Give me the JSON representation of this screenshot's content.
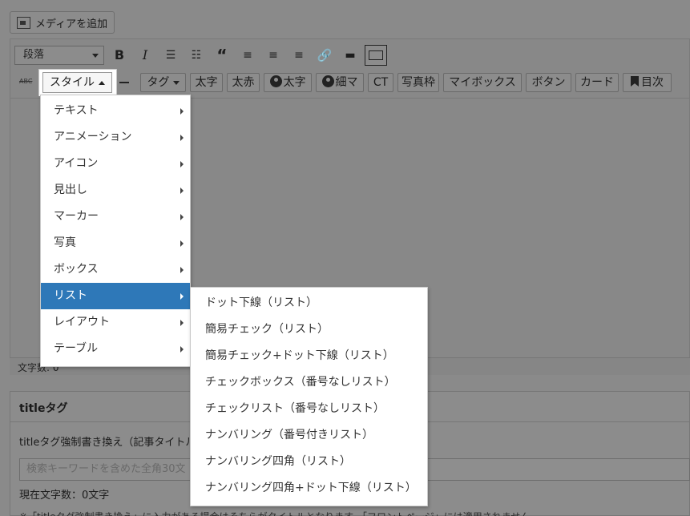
{
  "media_button": {
    "label": "メディアを追加"
  },
  "toolbar": {
    "format_select": "段落",
    "row2_buttons": {
      "style": "スタイル",
      "tag": "タグ",
      "bold": "太字",
      "bold_red": "太赤",
      "avatar_bold": "太字",
      "avatar_thin": "細マ",
      "ct": "CT",
      "photo_frame": "写真枠",
      "my_box": "マイボックス",
      "button": "ボタン",
      "card": "カード",
      "toc": "目次"
    },
    "strikethrough_label": "ABC"
  },
  "style_menu": {
    "items": [
      {
        "label": "テキスト"
      },
      {
        "label": "アニメーション"
      },
      {
        "label": "アイコン"
      },
      {
        "label": "見出し"
      },
      {
        "label": "マーカー"
      },
      {
        "label": "写真"
      },
      {
        "label": "ボックス"
      },
      {
        "label": "リスト"
      },
      {
        "label": "レイアウト"
      },
      {
        "label": "テーブル"
      }
    ],
    "active_index": 7
  },
  "list_submenu": {
    "items": [
      {
        "label": "ドット下線（リスト）"
      },
      {
        "label": "簡易チェック（リスト）"
      },
      {
        "label": "簡易チェック+ドット下線（リスト）"
      },
      {
        "label": "チェックボックス（番号なしリスト）"
      },
      {
        "label": "チェックリスト（番号なしリスト）"
      },
      {
        "label": "ナンバリング（番号付きリスト）"
      },
      {
        "label": "ナンバリング四角（リスト）"
      },
      {
        "label": "ナンバリング四角+ドット下線（リスト）"
      }
    ]
  },
  "editor": {
    "word_count": "文字数: 0"
  },
  "title_panel": {
    "title": "titleタグ",
    "override_label": "titleタグ強制書き換え（記事タイトル",
    "input_placeholder": "検索キーワードを含めた全角30文",
    "char_count": "現在文字数：0文字",
    "note": "※「titleタグ強制書き換え」に入力がある場合はそちらがタイトルとなります。「フロントページ」には適用されません。"
  },
  "colors": {
    "menu_active_bg": "#2e78b8",
    "overlay_bg": "#8a8a8a",
    "menu_bg": "#ffffff"
  }
}
